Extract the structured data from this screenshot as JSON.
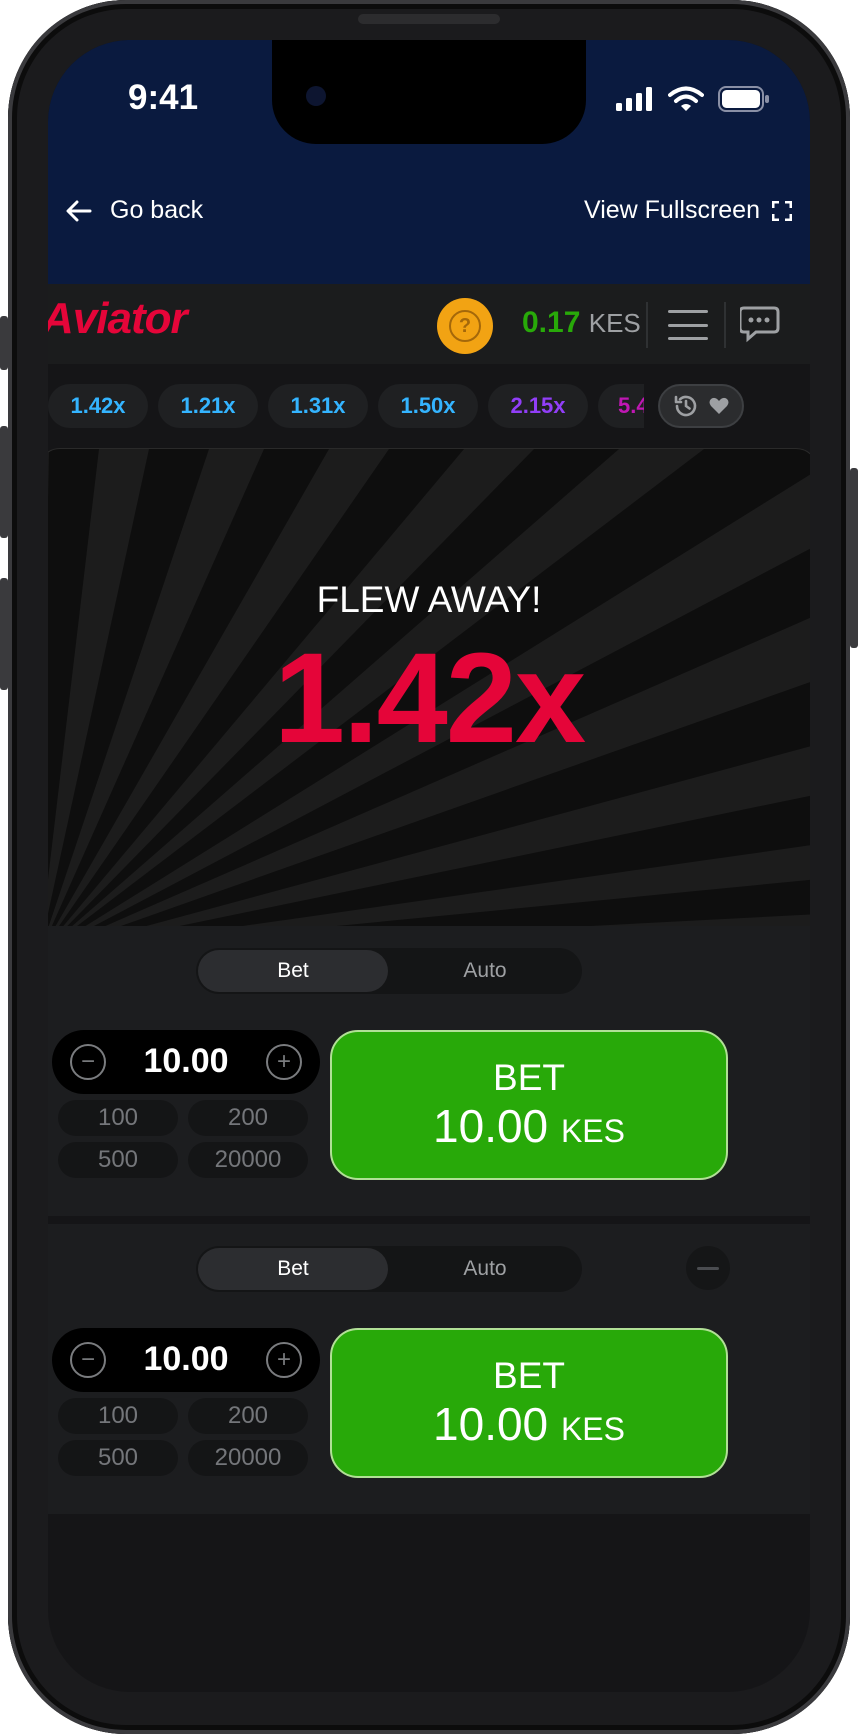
{
  "status_bar": {
    "time": "9:41"
  },
  "nav": {
    "go_back": "Go back",
    "fullscreen": "View Fullscreen"
  },
  "header": {
    "logo": "Aviator",
    "help_symbol": "?",
    "balance_amount": "0.17",
    "balance_currency": "KES"
  },
  "history": {
    "multipliers": [
      {
        "value": "1.42x",
        "color": "#34b4ff"
      },
      {
        "value": "1.21x",
        "color": "#34b4ff"
      },
      {
        "value": "1.31x",
        "color": "#34b4ff"
      },
      {
        "value": "1.50x",
        "color": "#34b4ff"
      },
      {
        "value": "2.15x",
        "color": "#913ef8"
      },
      {
        "value": "5.4",
        "color": "#c017b4"
      }
    ]
  },
  "game": {
    "status_text": "FLEW AWAY!",
    "multiplier": "1.42x",
    "multiplier_color": "#e50539"
  },
  "bet_panels": [
    {
      "tab_bet": "Bet",
      "tab_auto": "Auto",
      "stake": "10.00",
      "minus": "−",
      "plus": "+",
      "quick_amounts": [
        "100",
        "200",
        "500",
        "20000"
      ],
      "button_label": "BET",
      "button_amount": "10.00",
      "button_currency": "KES"
    },
    {
      "tab_bet": "Bet",
      "tab_auto": "Auto",
      "stake": "10.00",
      "minus": "−",
      "plus": "+",
      "quick_amounts": [
        "100",
        "200",
        "500",
        "20000"
      ],
      "button_label": "BET",
      "button_amount": "10.00",
      "button_currency": "KES"
    }
  ],
  "colors": {
    "nav_background": "#0a1a3f",
    "accent_green": "#28a909",
    "accent_red": "#e50539",
    "help_orange": "#f2a313"
  },
  "icons": {
    "back": "arrow-left-icon",
    "fullscreen": "fullscreen-icon",
    "help": "question-icon",
    "menu": "hamburger-icon",
    "chat": "chat-icon",
    "history": "history-icon",
    "favorite": "heart-icon"
  }
}
